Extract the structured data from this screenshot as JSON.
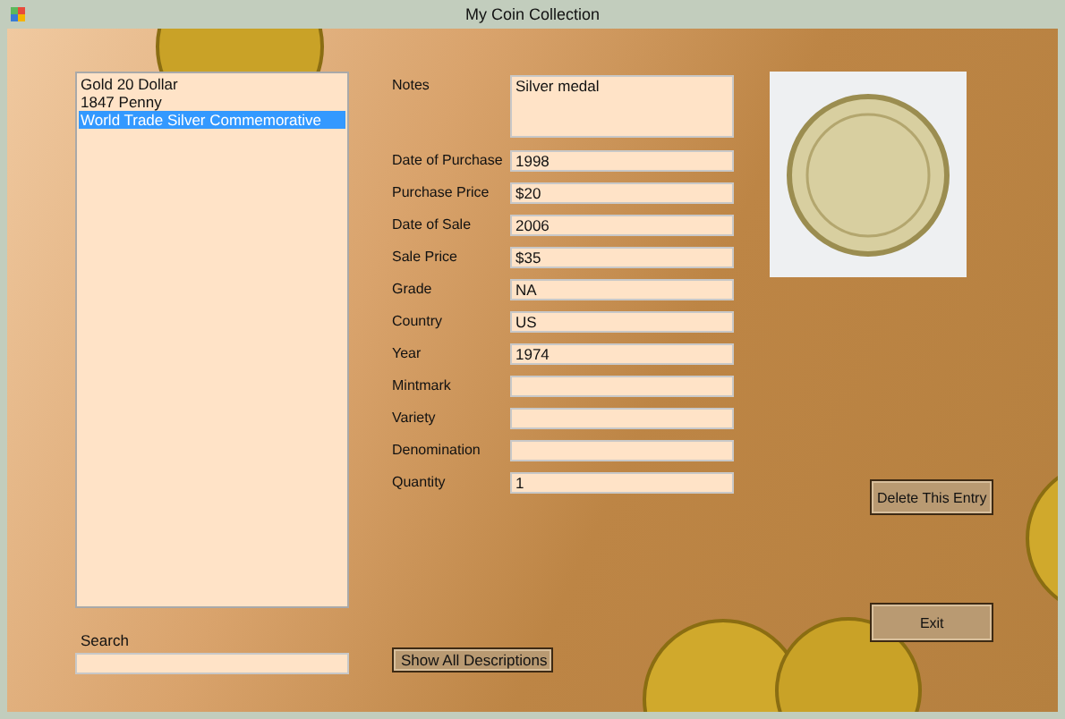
{
  "window": {
    "title": "My Coin Collection"
  },
  "coin_list": {
    "items": [
      {
        "label": "Gold 20 Dollar",
        "selected": false
      },
      {
        "label": "1847 Penny",
        "selected": false
      },
      {
        "label": "World Trade Silver Commemorative",
        "selected": true
      }
    ]
  },
  "search": {
    "label": "Search"
  },
  "notes": {
    "label": "Notes",
    "value": "Silver medal"
  },
  "fields": [
    {
      "label": "Date of Purchase",
      "value": "1998"
    },
    {
      "label": "Purchase Price",
      "value": "$20"
    },
    {
      "label": "Date of Sale",
      "value": "2006"
    },
    {
      "label": "Sale Price",
      "value": "$35"
    },
    {
      "label": "Grade",
      "value": "NA"
    },
    {
      "label": "Country",
      "value": "US"
    },
    {
      "label": "Year",
      "value": "1974"
    },
    {
      "label": "Mintmark"
    },
    {
      "label": "Variety"
    },
    {
      "label": "Denomination"
    },
    {
      "label": "Quantity",
      "value": "1"
    }
  ],
  "buttons": {
    "delete": "Delete This Entry",
    "show_all": "Show All Descriptions",
    "exit": "Exit"
  }
}
